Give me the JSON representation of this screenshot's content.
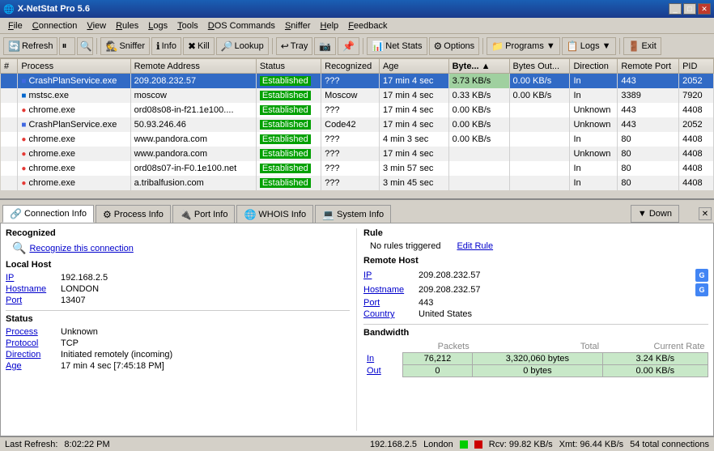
{
  "titleBar": {
    "icon": "🌐",
    "title": "X-NetStat Pro 5.6",
    "controls": [
      "minimize",
      "maximize",
      "close"
    ]
  },
  "menuBar": {
    "items": [
      {
        "label": "File",
        "underline": 0
      },
      {
        "label": "Connection",
        "underline": 0
      },
      {
        "label": "View",
        "underline": 0
      },
      {
        "label": "Rules",
        "underline": 0
      },
      {
        "label": "Logs",
        "underline": 0
      },
      {
        "label": "Tools",
        "underline": 0
      },
      {
        "label": "DOS Commands",
        "underline": 0
      },
      {
        "label": "Sniffer",
        "underline": 0
      },
      {
        "label": "Help",
        "underline": 0
      },
      {
        "label": "Feedback",
        "underline": 0
      }
    ]
  },
  "toolbar": {
    "buttons": [
      {
        "id": "refresh",
        "icon": "🔄",
        "label": "Refresh"
      },
      {
        "id": "pause",
        "icon": "⏸",
        "label": ""
      },
      {
        "id": "find",
        "icon": "🔍",
        "label": ""
      },
      {
        "id": "sniffer",
        "icon": "🕵",
        "label": "Sniffer"
      },
      {
        "id": "info",
        "icon": "ℹ",
        "label": "Info"
      },
      {
        "id": "kill",
        "icon": "💀",
        "label": "Kill"
      },
      {
        "id": "lookup",
        "icon": "🔎",
        "label": "Lookup"
      },
      {
        "id": "tray",
        "icon": "📌",
        "label": "Tray"
      },
      {
        "id": "netstats",
        "icon": "📊",
        "label": "Net Stats"
      },
      {
        "id": "options",
        "icon": "⚙",
        "label": "Options"
      },
      {
        "id": "programs",
        "icon": "📁",
        "label": "Programs ▼"
      },
      {
        "id": "logs",
        "icon": "📋",
        "label": "Logs ▼"
      },
      {
        "id": "exit",
        "icon": "🚪",
        "label": "Exit"
      }
    ]
  },
  "table": {
    "columns": [
      "#",
      "Process",
      "Remote Address",
      "Status",
      "Recognized",
      "Age",
      "Bytes...",
      "Bytes Out...",
      "Direction",
      "Remote Port",
      "PID"
    ],
    "rows": [
      {
        "num": "",
        "process": "CrashPlanService.exe",
        "remote": "209.208.232.57",
        "status": "Established",
        "recognized": "???",
        "age": "17 min 4 sec",
        "bytes_in": "3.73 KB/s",
        "bytes_out": "0.00 KB/s",
        "direction": "In",
        "port": "443",
        "pid": "2052",
        "selected": true
      },
      {
        "num": "",
        "process": "mstsc.exe",
        "remote": "moscow",
        "status": "Established",
        "recognized": "Moscow",
        "age": "17 min 4 sec",
        "bytes_in": "0.33 KB/s",
        "bytes_out": "0.00 KB/s",
        "direction": "In",
        "port": "3389",
        "pid": "7920",
        "selected": false
      },
      {
        "num": "",
        "process": "chrome.exe",
        "remote": "ord08s08-in-f21.1e100...",
        "status": "Established",
        "recognized": "???",
        "age": "17 min 4 sec",
        "bytes_in": "0.00 KB/s",
        "bytes_out": "",
        "direction": "Unknown",
        "port": "443",
        "pid": "4408",
        "selected": false
      },
      {
        "num": "",
        "process": "CrashPlanService.exe",
        "remote": "50.93.246.46",
        "status": "Established",
        "recognized": "Code42",
        "age": "17 min 4 sec",
        "bytes_in": "0.00 KB/s",
        "bytes_out": "",
        "direction": "Unknown",
        "port": "443",
        "pid": "2052",
        "selected": false
      },
      {
        "num": "",
        "process": "chrome.exe",
        "remote": "www.pandora.com",
        "status": "Established",
        "recognized": "???",
        "age": "4 min 3 sec",
        "bytes_in": "0.00 KB/s",
        "bytes_out": "",
        "direction": "In",
        "port": "80",
        "pid": "4408",
        "selected": false
      },
      {
        "num": "",
        "process": "chrome.exe",
        "remote": "www.pandora.com",
        "status": "Established",
        "recognized": "???",
        "age": "17 min 4 sec",
        "bytes_in": "",
        "bytes_out": "",
        "direction": "Unknown",
        "port": "80",
        "pid": "4408",
        "selected": false
      },
      {
        "num": "",
        "process": "chrome.exe",
        "remote": "ord08s07-in-F0.1e100.net",
        "status": "Established",
        "recognized": "???",
        "age": "3 min 57 sec",
        "bytes_in": "",
        "bytes_out": "",
        "direction": "In",
        "port": "80",
        "pid": "4408",
        "selected": false
      },
      {
        "num": "",
        "process": "chrome.exe",
        "remote": "a.tribalfusion.com",
        "status": "Established",
        "recognized": "???",
        "age": "3 min 45 sec",
        "bytes_in": "",
        "bytes_out": "",
        "direction": "In",
        "port": "80",
        "pid": "4408",
        "selected": false
      }
    ]
  },
  "bottomPanel": {
    "tabs": [
      {
        "id": "connection",
        "icon": "🔗",
        "label": "Connection Info",
        "active": true
      },
      {
        "id": "process",
        "icon": "⚙",
        "label": "Process Info",
        "active": false
      },
      {
        "id": "port",
        "icon": "🔌",
        "label": "Port Info",
        "active": false
      },
      {
        "id": "whois",
        "icon": "🌐",
        "label": "WHOIS Info",
        "active": false
      },
      {
        "id": "system",
        "icon": "💻",
        "label": "System Info",
        "active": false
      }
    ],
    "downButton": "▼ Down",
    "connectionInfo": {
      "recognized": {
        "title": "Recognized",
        "recognizeLink": "Recognize this connection"
      },
      "rule": {
        "title": "Rule",
        "noRules": "No rules triggered",
        "editRule": "Edit Rule"
      },
      "localHost": {
        "title": "Local Host",
        "ipLabel": "IP",
        "ipValue": "192.168.2.5",
        "hostnameLabel": "Hostname",
        "hostnameValue": "LONDON",
        "portLabel": "Port",
        "portValue": "13407"
      },
      "remoteHost": {
        "title": "Remote Host",
        "ipLabel": "IP",
        "ipValue": "209.208.232.57",
        "hostnameLabel": "Hostname",
        "hostnameValue": "209.208.232.57",
        "portLabel": "Port",
        "portValue": "443",
        "countryLabel": "Country",
        "countryValue": "United States"
      },
      "status": {
        "title": "Status",
        "processLabel": "Process",
        "processValue": "Unknown",
        "protocolLabel": "Protocol",
        "protocolValue": "TCP",
        "directionLabel": "Direction",
        "directionValue": "Initiated remotely (incoming)",
        "ageLabel": "Age",
        "ageValue": "17 min 4 sec [7:45:18 PM]"
      },
      "bandwidth": {
        "title": "Bandwidth",
        "headers": [
          "",
          "Packets",
          "Total",
          "Current Rate"
        ],
        "rows": [
          {
            "label": "In",
            "packets": "76,212",
            "total": "3,320,060 bytes",
            "rate": "3.24 KB/s"
          },
          {
            "label": "Out",
            "packets": "0",
            "total": "0 bytes",
            "rate": "0.00 KB/s"
          }
        ]
      }
    }
  },
  "statusBar": {
    "lastRefresh": "Last Refresh:",
    "time": "8:02:22 PM",
    "ip": "192.168.2.5",
    "hostname": "London",
    "rcv": "Rcv: 99.82 KB/s",
    "xmt": "Xmt: 96.44 KB/s",
    "connections": "54 total connections"
  }
}
